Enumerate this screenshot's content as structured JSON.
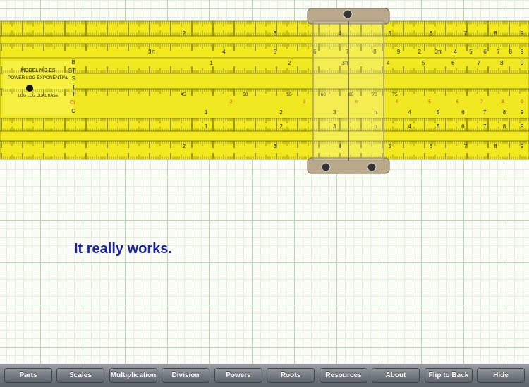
{
  "tagline": "It really works.",
  "rule": {
    "model": "MODEL N 3-ES",
    "type": "POWER LOG EXPONENTIAL",
    "subtitle": "LOG LOG DUAL BASE",
    "scale_letters": [
      "B",
      "ST",
      "S",
      "T",
      "T",
      "CI",
      "C"
    ],
    "top_scale_numbers": [
      "2",
      "3",
      "4",
      "5",
      "6",
      "7",
      "8",
      "9"
    ],
    "a_scale_numbers": [
      "3π",
      "4",
      "5",
      "6",
      "7",
      "8",
      "9",
      "2",
      "3π",
      "4",
      "5",
      "6",
      "7",
      "8",
      "9"
    ],
    "b_scale_numbers": [
      "1",
      "2",
      "3π",
      "4",
      "5",
      "6",
      "7",
      "8",
      "9"
    ],
    "c_scale_numbers": [
      "1",
      "2",
      "3",
      "π",
      "4",
      "5",
      "6",
      "7",
      "8",
      "9"
    ],
    "d_scale_numbers": [
      "1",
      "2",
      "3",
      "π",
      "4",
      "5",
      "6",
      "7",
      "8",
      "9"
    ],
    "bottom_scale_numbers": [
      "2",
      "3",
      "4",
      "5",
      "6",
      "7",
      "8",
      "9"
    ],
    "t_scale_numbers": [
      "45",
      "50",
      "55",
      "60",
      "65",
      "70",
      "75"
    ],
    "colors": {
      "body": "#f2ea1f",
      "ink": "#1b1b1b",
      "red": "#d83a2a",
      "cursor": "#b9a98a",
      "grid_major": "#b6d7b6",
      "grid_minor": "#e2efe0",
      "tagline": "#1c23a0"
    }
  },
  "toolbar": {
    "buttons": [
      "Parts",
      "Scales",
      "Multiplication",
      "Division",
      "Powers",
      "Roots",
      "Resources",
      "About",
      "Flip to Back",
      "Hide"
    ]
  }
}
